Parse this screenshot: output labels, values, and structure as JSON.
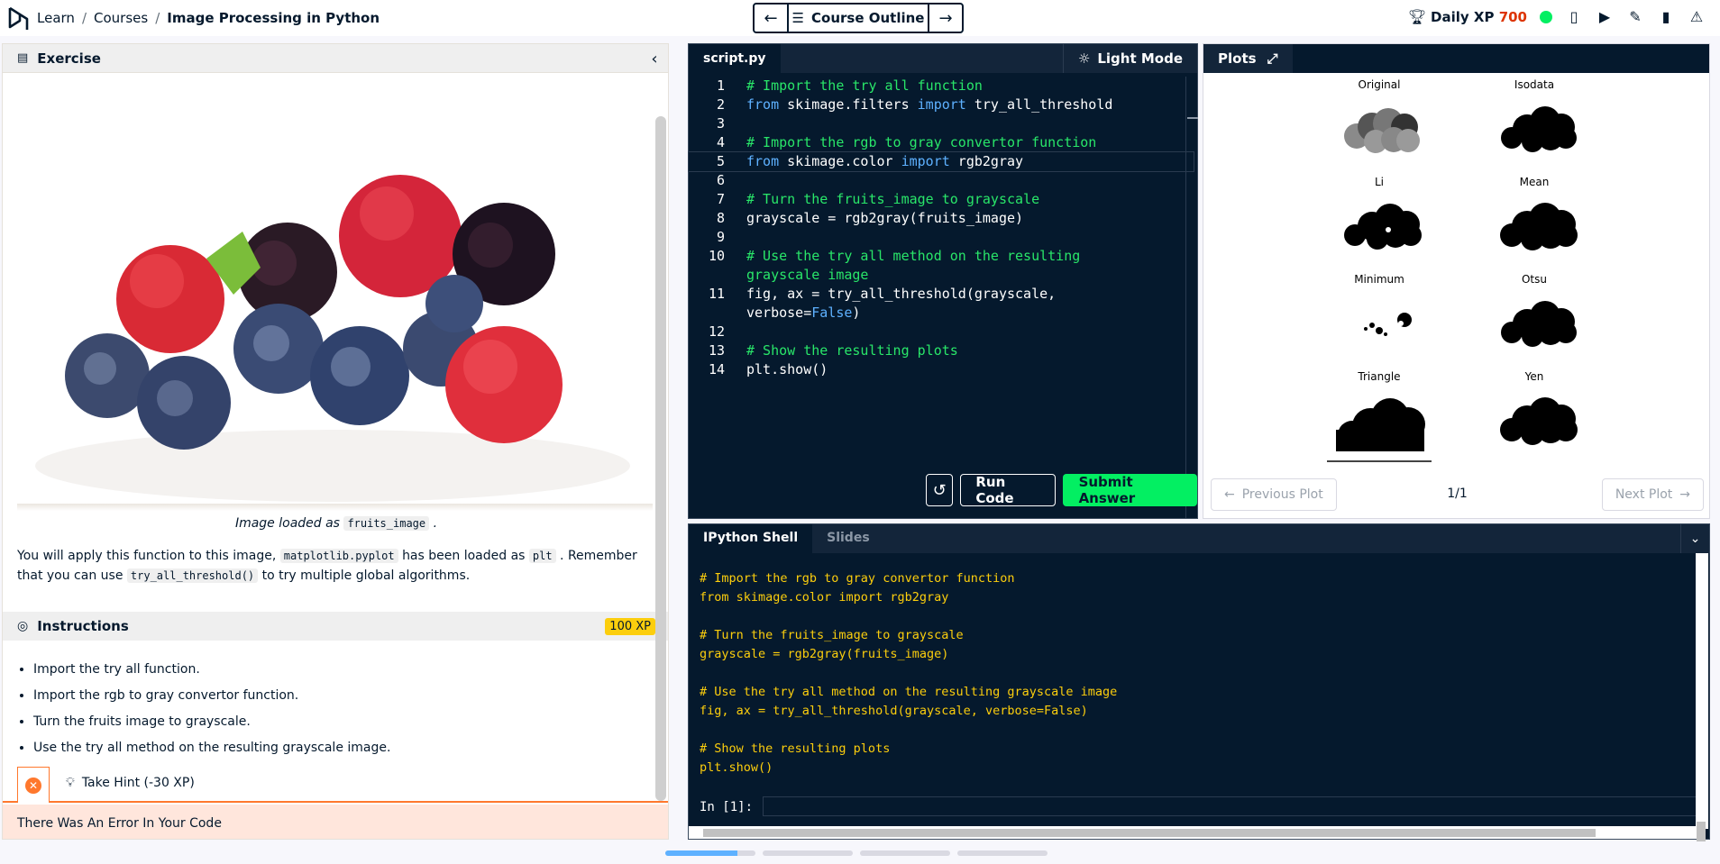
{
  "header": {
    "breadcrumb": [
      "Learn",
      "Courses",
      "Image Processing in Python"
    ],
    "course_outline": "Course Outline",
    "daily_xp_label": "Daily XP",
    "daily_xp_value": "700"
  },
  "exercise": {
    "header": "Exercise",
    "caption_text": "Image loaded as",
    "caption_code": "fruits_image",
    "para_1": "You will apply this function to this image,",
    "para_code_1": "matplotlib.pyplot",
    "para_2": "has been loaded as",
    "para_code_2": "plt",
    "para_3": ". Remember that you can use",
    "para_code_3": "try_all_threshold()",
    "para_4": "to try multiple global algorithms."
  },
  "instructions": {
    "header": "Instructions",
    "xp_badge": "100 XP",
    "items": [
      "Import the try all function.",
      "Import the rgb to gray convertor function.",
      "Turn the fruits image to grayscale.",
      "Use the try all method on the resulting grayscale image."
    ],
    "hint": "Take Hint (-30 XP)",
    "error": "There Was An Error In Your Code"
  },
  "editor": {
    "tab": "script.py",
    "light_mode": "Light Mode",
    "run_code": "Run Code",
    "submit": "Submit Answer"
  },
  "plots": {
    "tab": "Plots",
    "labels": [
      "Original",
      "Isodata",
      "Li",
      "Mean",
      "Minimum",
      "Otsu",
      "Triangle",
      "Yen"
    ],
    "prev": "Previous Plot",
    "next": "Next Plot",
    "counter": "1/1"
  },
  "shell": {
    "tab_shell": "IPython Shell",
    "tab_slides": "Slides",
    "output": "# Import the rgb to gray convertor function\nfrom skimage.color import rgb2gray\n\n# Turn the fruits_image to grayscale\ngrayscale = rgb2gray(fruits_image)\n\n# Use the try all method on the resulting grayscale image\nfig, ax = try_all_threshold(grayscale, verbose=False)\n\n# Show the resulting plots\nplt.show()",
    "prompt": "In [1]:"
  },
  "colors": {
    "brand_green": "#03ef62",
    "navy": "#05192d",
    "xp_red": "#dd3400",
    "code_comment": "#29e669",
    "code_keyword": "#5eb1ff",
    "shell_text": "#fcce0d"
  },
  "icons": [
    "logo-icon",
    "arrow-left-icon",
    "menu-icon",
    "arrow-right-icon",
    "trophy-icon",
    "document-icon",
    "video-icon",
    "pencil-icon",
    "mobile-icon",
    "warning-icon",
    "exercise-icon",
    "collapse-icon",
    "check-circle-icon",
    "close-icon",
    "lightbulb-icon",
    "sun-icon",
    "expand-icon",
    "reset-icon",
    "chevron-down-icon"
  ]
}
